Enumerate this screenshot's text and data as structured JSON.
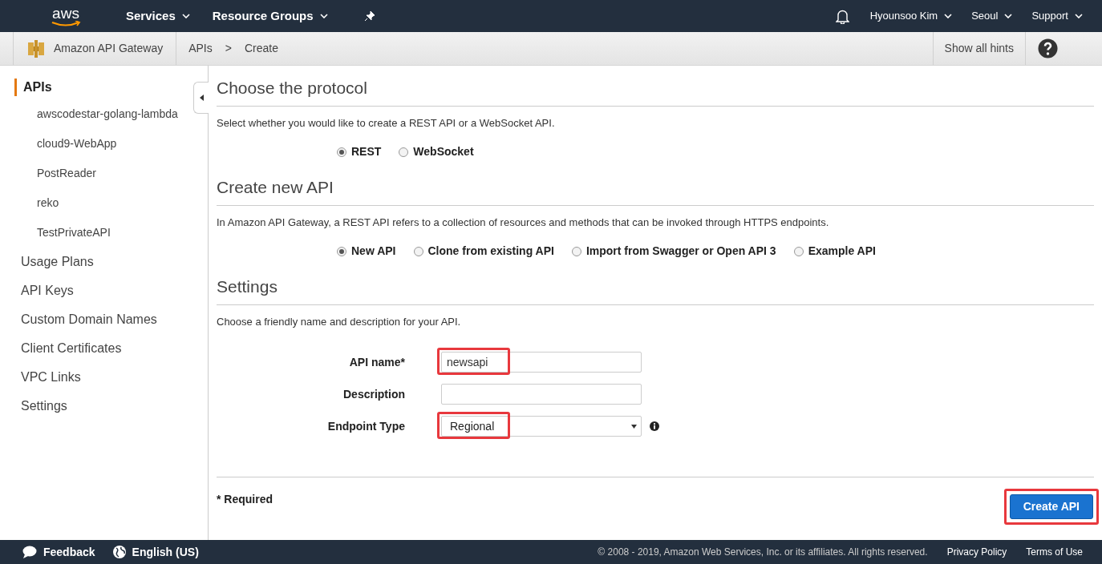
{
  "top_nav": {
    "logo": "aws",
    "menus": [
      {
        "label": "Services"
      },
      {
        "label": "Resource Groups"
      }
    ],
    "right_menus": [
      {
        "label": "Hyounsoo Kim"
      },
      {
        "label": "Seoul"
      },
      {
        "label": "Support"
      }
    ]
  },
  "breadcrumb_bar": {
    "service": "Amazon API Gateway",
    "crumbs": [
      "APIs",
      ">",
      "Create"
    ],
    "hints_button": "Show all hints"
  },
  "sidebar": {
    "items": [
      {
        "label": "APIs",
        "selected": true,
        "children": [
          {
            "label": "awscodestar-golang-lambda"
          },
          {
            "label": "cloud9-WebApp"
          },
          {
            "label": "PostReader"
          },
          {
            "label": "reko"
          },
          {
            "label": "TestPrivateAPI"
          }
        ]
      },
      {
        "label": "Usage Plans",
        "selected": false
      },
      {
        "label": "API Keys",
        "selected": false
      },
      {
        "label": "Custom Domain Names",
        "selected": false
      },
      {
        "label": "Client Certificates",
        "selected": false
      },
      {
        "label": "VPC Links",
        "selected": false
      },
      {
        "label": "Settings",
        "selected": false
      }
    ]
  },
  "sections": [
    {
      "title": "Choose the protocol",
      "description": "Select whether you would like to create a REST API or a WebSocket API.",
      "radios": [
        {
          "label": "REST",
          "selected": true
        },
        {
          "label": "WebSocket",
          "selected": false
        }
      ]
    },
    {
      "title": "Create new API",
      "description": "In Amazon API Gateway, a REST API refers to a collection of resources and methods that can be invoked through HTTPS endpoints.",
      "radios": [
        {
          "label": "New API",
          "selected": true
        },
        {
          "label": "Clone from existing API",
          "selected": false
        },
        {
          "label": "Import from Swagger or Open API 3",
          "selected": false
        },
        {
          "label": "Example API",
          "selected": false
        }
      ]
    },
    {
      "title": "Settings",
      "description": "Choose a friendly name and description for your API."
    }
  ],
  "form": [
    {
      "kind": "text",
      "label": "API name*",
      "value": "newsapi",
      "highlighted": true
    },
    {
      "kind": "text",
      "label": "Description"
    },
    {
      "kind": "select",
      "label": "Endpoint Type",
      "value": "Regional",
      "highlighted": true,
      "info": true
    }
  ],
  "required_note": "* Required",
  "submit": {
    "label": "Create API",
    "highlighted": true
  },
  "footer": {
    "feedback": "Feedback",
    "language": "English (US)",
    "copyright": "© 2008 - 2019, Amazon Web Services, Inc. or its affiliates. All rights reserved.",
    "links": [
      "Privacy Policy",
      "Terms of Use"
    ]
  }
}
